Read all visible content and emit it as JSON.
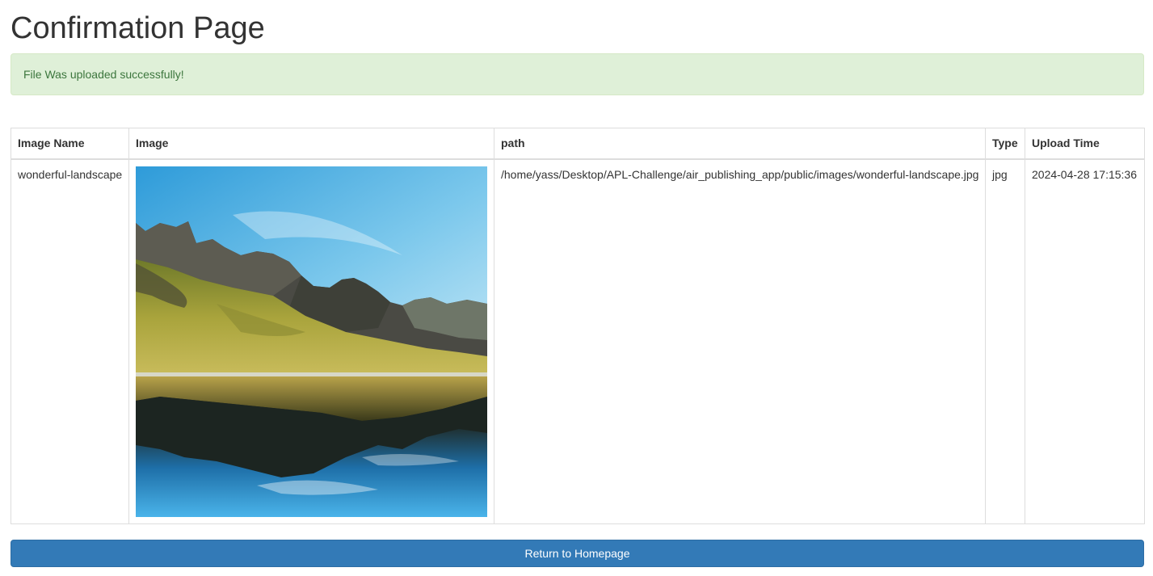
{
  "page": {
    "title": "Confirmation Page"
  },
  "alert": {
    "message": "File Was uploaded successfully!",
    "background": "#dff0d8",
    "text_color": "#3c763d"
  },
  "table": {
    "headers": {
      "image_name": "Image Name",
      "image": "Image",
      "path": "path",
      "type": "Type",
      "upload_time": "Upload Time"
    },
    "rows": [
      {
        "image_name": "wonderful-landscape",
        "image_icon": "landscape-photo",
        "path": "/home/yass/Desktop/APL-Challenge/air_publishing_app/public/images/wonderful-landscape.jpg",
        "type": "jpg",
        "upload_time": "2024-04-28 17:15:36"
      }
    ]
  },
  "actions": {
    "return_label": "Return to Homepage",
    "primary_color": "#337ab7"
  }
}
